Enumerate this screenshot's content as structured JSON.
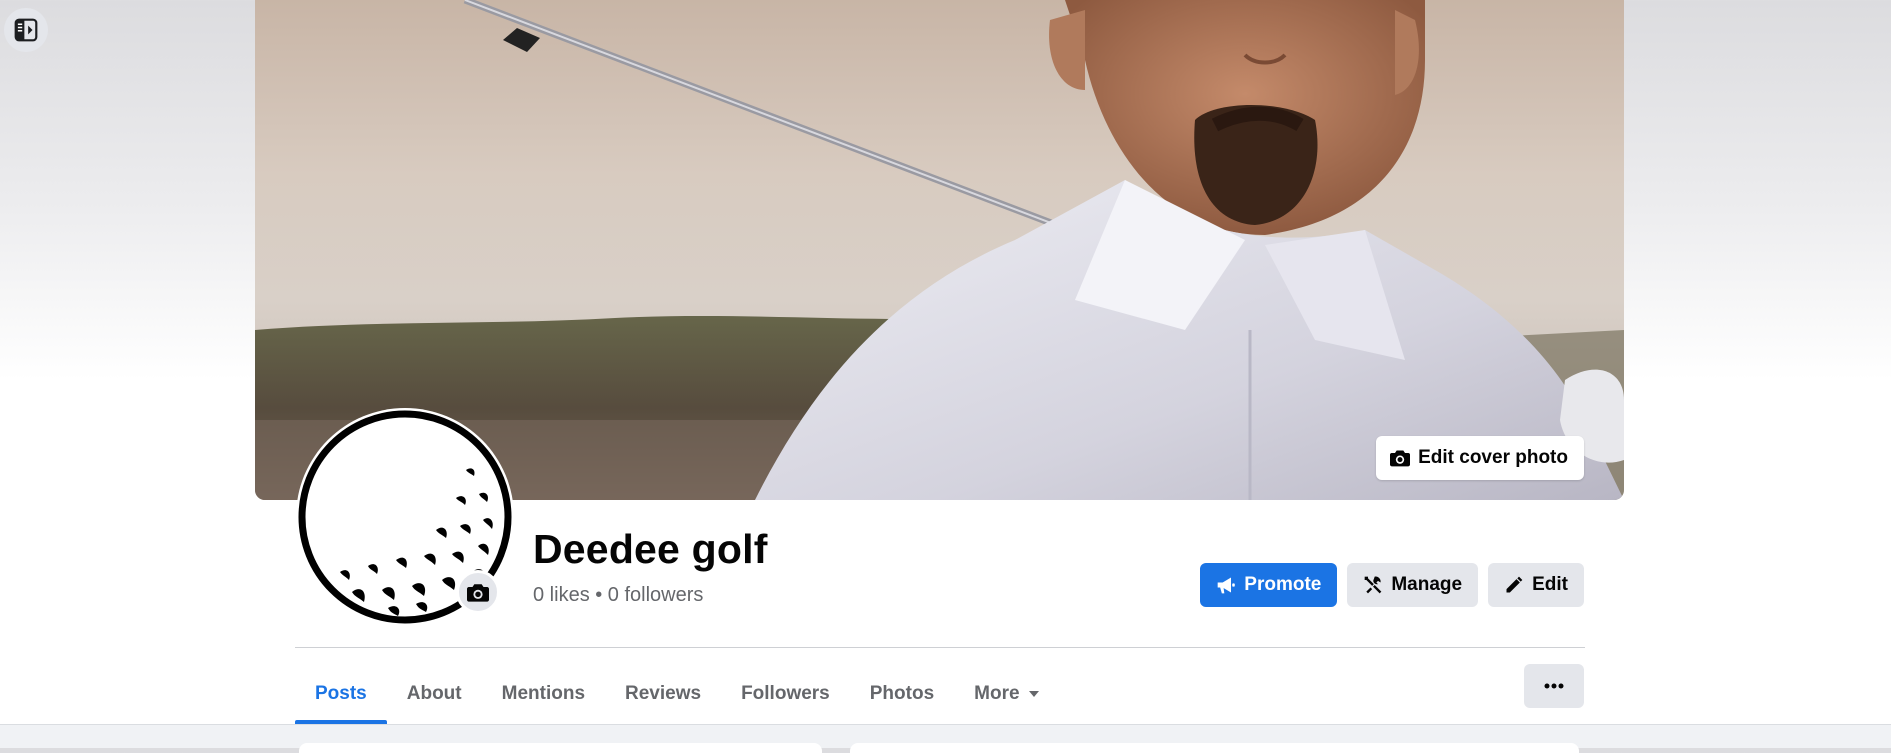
{
  "sidebar": {
    "toggle_icon": "sidebar-panel-icon"
  },
  "cover": {
    "edit_cover_label": "Edit cover photo",
    "edit_cover_icon": "camera-icon"
  },
  "profile": {
    "avatar_icon": "golf-ball-icon",
    "avatar_camera_icon": "camera-icon",
    "name": "Deedee golf",
    "stats": "0 likes • 0 followers"
  },
  "actions": {
    "promote_label": "Promote",
    "promote_icon": "megaphone-icon",
    "manage_label": "Manage",
    "manage_icon": "tools-icon",
    "edit_label": "Edit",
    "edit_icon": "pencil-icon"
  },
  "tabs": [
    {
      "label": "Posts",
      "active": true
    },
    {
      "label": "About"
    },
    {
      "label": "Mentions"
    },
    {
      "label": "Reviews"
    },
    {
      "label": "Followers"
    },
    {
      "label": "Photos"
    },
    {
      "label": "More",
      "icon": "caret-down-icon"
    }
  ],
  "more_options_icon": "ellipsis-icon",
  "colors": {
    "accent": "#1b74e4",
    "secondary_button": "#e4e6eb",
    "muted_text": "#65676b",
    "primary_text": "#050505"
  }
}
